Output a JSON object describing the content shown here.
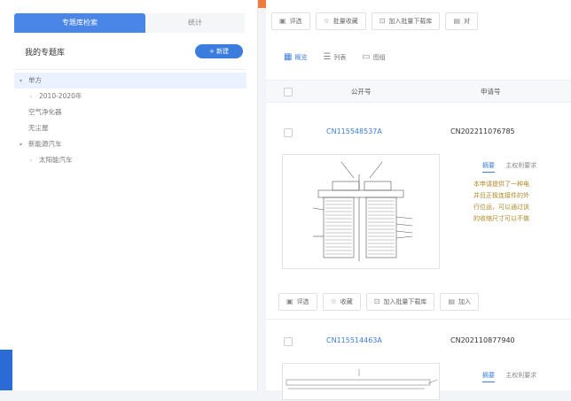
{
  "left_panel": {
    "tabs": [
      "专题库检索",
      "统计"
    ],
    "title": "我的专题库",
    "new_button": "+ 新建",
    "tree": [
      {
        "caret": "▾",
        "label": "单方",
        "level": 0,
        "selected": true
      },
      {
        "caret": "›",
        "label": "2010-2020年",
        "level": 1,
        "selected": false
      },
      {
        "caret": "",
        "label": "空气净化器",
        "level": 0,
        "selected": false
      },
      {
        "caret": "",
        "label": "无尘屋",
        "level": 0,
        "selected": false
      },
      {
        "caret": "▾",
        "label": "新能源汽车",
        "level": 0,
        "selected": false
      },
      {
        "caret": "›",
        "label": "太阳能汽车",
        "level": 1,
        "selected": false
      }
    ]
  },
  "toolbar": [
    {
      "icon": "filter-icon",
      "glyph": "▣",
      "label": "评选"
    },
    {
      "icon": "star-icon",
      "glyph": "☆",
      "label": "批量收藏"
    },
    {
      "icon": "download-icon",
      "glyph": "⊡",
      "label": "加入批量下载库"
    },
    {
      "icon": "compare-icon",
      "glyph": "▤",
      "label": "对"
    }
  ],
  "view_modes": [
    {
      "icon": "summary-view-icon",
      "glyph": "▦",
      "label": "概览",
      "active": true
    },
    {
      "icon": "list-view-icon",
      "glyph": "☰",
      "label": "列表",
      "active": false
    },
    {
      "icon": "image-view-icon",
      "glyph": "▭",
      "label": "图组",
      "active": false
    }
  ],
  "table": {
    "headers": [
      "公开号",
      "申请号"
    ]
  },
  "results": [
    {
      "publication_no": "CN115548537A",
      "application_no": "CN202211076785",
      "abstract_tabs": [
        "摘要",
        "主权利要求"
      ],
      "abstract_lines": [
        "本申请提供了一种电",
        "并且正极连接件的外",
        "行位运，可以通过该",
        "的收缩尺寸可以不做"
      ]
    },
    {
      "publication_no": "CN115514463A",
      "application_no": "CN202110877940",
      "abstract_tabs": [
        "摘要",
        "主权利要求"
      ],
      "abstract_lines": []
    }
  ],
  "row_actions": [
    {
      "icon": "filter-icon",
      "glyph": "▣",
      "label": "评选"
    },
    {
      "icon": "star-icon",
      "glyph": "☆",
      "label": "收藏"
    },
    {
      "icon": "download-icon",
      "glyph": "⊡",
      "label": "加入批量下载库"
    },
    {
      "icon": "compare-icon",
      "glyph": "▤",
      "label": "加入"
    }
  ],
  "colors": {
    "accent": "#3b7ddd",
    "banner": "#f07a3a"
  }
}
